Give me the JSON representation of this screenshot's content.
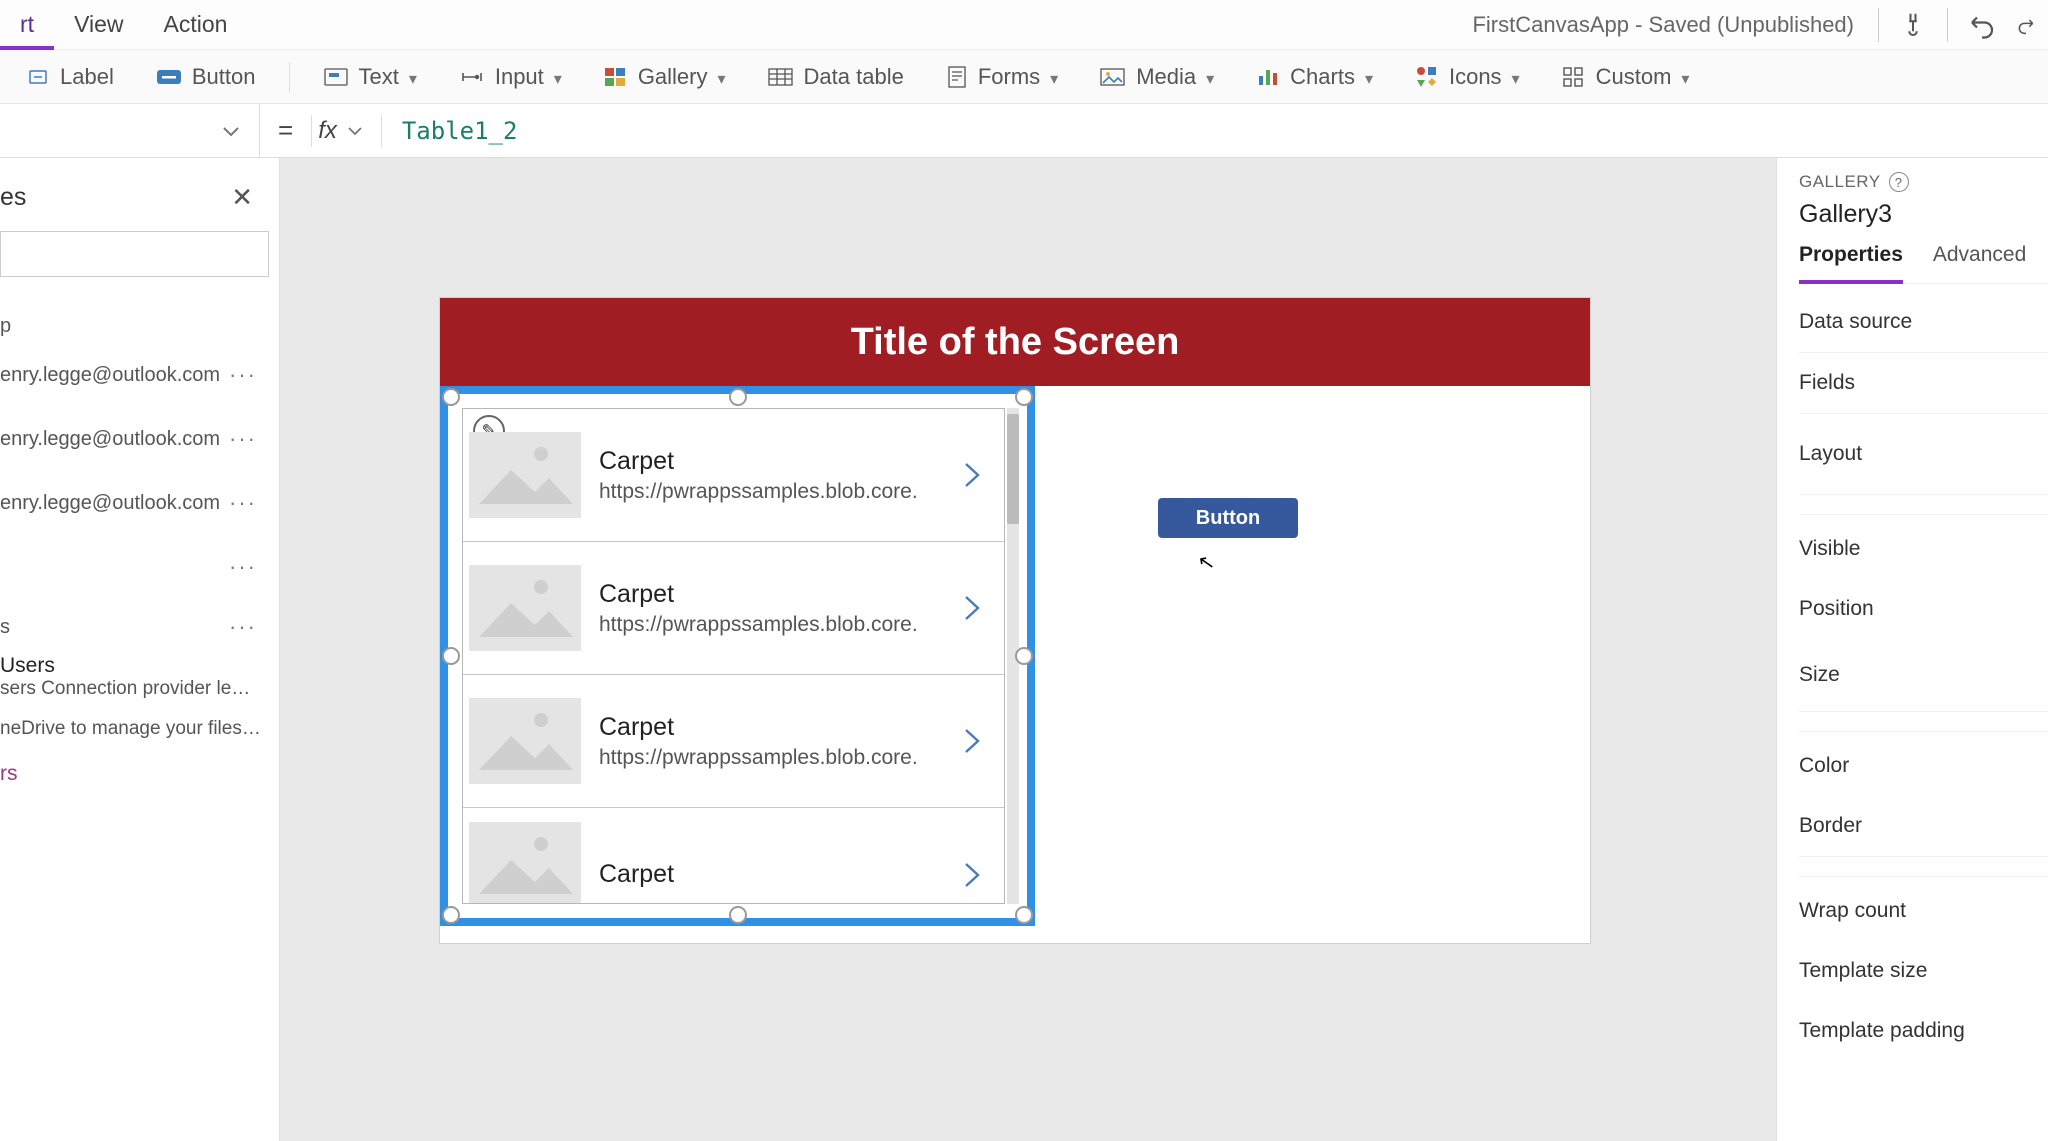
{
  "app": {
    "saved_label": "FirstCanvasApp - Saved (Unpublished)"
  },
  "menu": {
    "items": [
      "rt",
      "View",
      "Action"
    ],
    "active_index": 0
  },
  "ribbon": {
    "label": "Label",
    "button": "Button",
    "text": "Text",
    "input": "Input",
    "gallery": "Gallery",
    "data_table": "Data table",
    "forms": "Forms",
    "media": "Media",
    "charts": "Charts",
    "icons": "Icons",
    "custom": "Custom"
  },
  "formula": {
    "equals": "=",
    "fx": "fx",
    "value": "Table1_2"
  },
  "left_panel": {
    "title_fragment": "es",
    "row0": "p",
    "entries": [
      "enry.legge@outlook.com",
      "enry.legge@outlook.com",
      "enry.legge@outlook.com"
    ],
    "row_s": "s",
    "users_title": "Users",
    "users_desc": "sers Connection provider lets you ...",
    "onedrive_desc": "neDrive to manage your files. Yo...",
    "trailing": "rs"
  },
  "canvas": {
    "screen_title": "Title of the Screen",
    "button_label": "Button",
    "gallery_items": [
      {
        "title": "Carpet",
        "sub": "https://pwrappssamples.blob.core."
      },
      {
        "title": "Carpet",
        "sub": "https://pwrappssamples.blob.core."
      },
      {
        "title": "Carpet",
        "sub": "https://pwrappssamples.blob.core."
      },
      {
        "title": "Carpet",
        "sub": ""
      }
    ]
  },
  "props": {
    "caption": "GALLERY",
    "name": "Gallery3",
    "tabs": [
      "Properties",
      "Advanced"
    ],
    "rows": [
      "Data source",
      "Fields",
      "Layout",
      "Visible",
      "Position",
      "Size",
      "Color",
      "Border",
      "Wrap count",
      "Template size",
      "Template padding"
    ]
  }
}
